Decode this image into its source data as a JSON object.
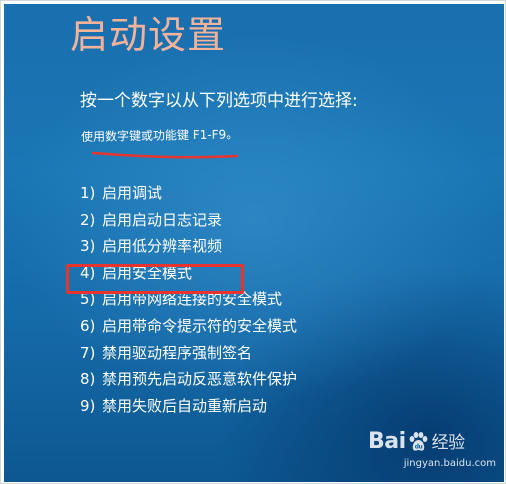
{
  "screen": {
    "title": "启动设置",
    "instruction": "按一个数字以从下列选项中进行选择:",
    "hint": "使用数字键或功能键 F1-F9。",
    "options": [
      {
        "number": "1)",
        "label": "启用调试"
      },
      {
        "number": "2)",
        "label": "启用启动日志记录"
      },
      {
        "number": "3)",
        "label": "启用低分辨率视频"
      },
      {
        "number": "4)",
        "label": "启用安全模式"
      },
      {
        "number": "5)",
        "label": "启用带网络连接的安全模式"
      },
      {
        "number": "6)",
        "label": "启用带命令提示符的安全模式"
      },
      {
        "number": "7)",
        "label": "禁用驱动程序强制签名"
      },
      {
        "number": "8)",
        "label": "禁用预先启动反恶意软件保护"
      },
      {
        "number": "9)",
        "label": "禁用失败后自动重新启动"
      }
    ],
    "highlighted_option": 4
  },
  "watermark": {
    "logo_text_a": "Bai",
    "logo_text_b": "经验",
    "url": "jingyan.baidu.com"
  },
  "colors": {
    "title": "#f3b39a",
    "text": "#ffffff",
    "background": "#1a6fae",
    "annotation_red": "#e8342e"
  }
}
